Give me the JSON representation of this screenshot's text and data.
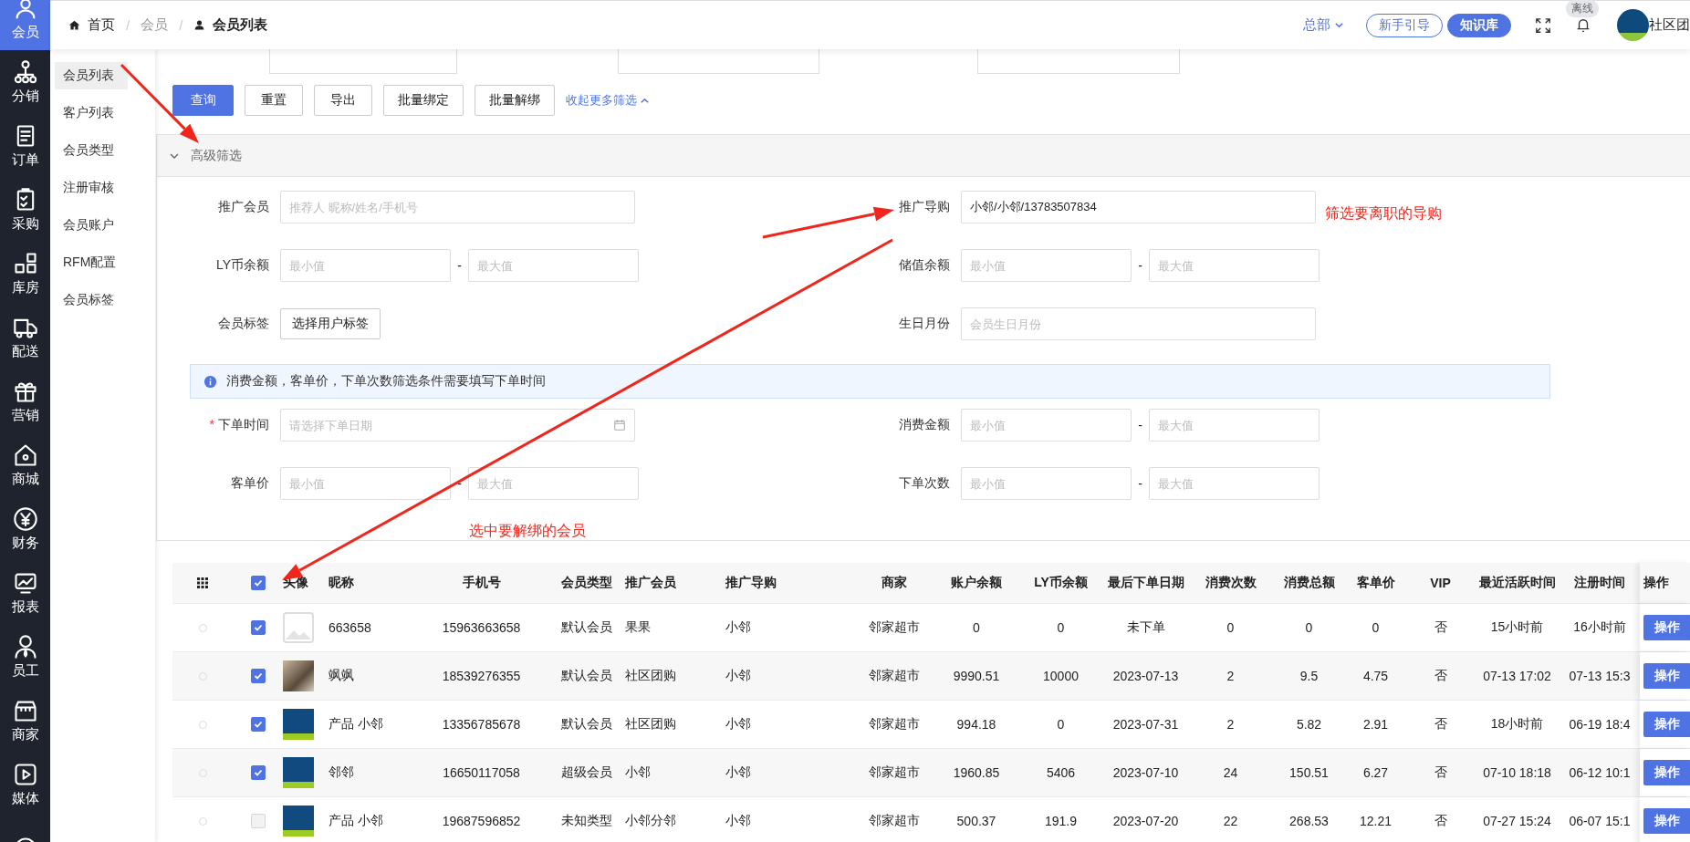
{
  "nav": {
    "items": [
      {
        "label": "会员",
        "selected": true
      },
      {
        "label": "分销",
        "selected": false
      },
      {
        "label": "订单",
        "selected": false
      },
      {
        "label": "采购",
        "selected": false
      },
      {
        "label": "库房",
        "selected": false
      },
      {
        "label": "配送",
        "selected": false
      },
      {
        "label": "营销",
        "selected": false
      },
      {
        "label": "商城",
        "selected": false
      },
      {
        "label": "财务",
        "selected": false
      },
      {
        "label": "报表",
        "selected": false
      },
      {
        "label": "员工",
        "selected": false
      },
      {
        "label": "商家",
        "selected": false
      },
      {
        "label": "媒体",
        "selected": false
      }
    ]
  },
  "breadcrumb": {
    "separator": "/",
    "items": [
      {
        "text": "首页",
        "kind": "home"
      },
      {
        "text": "会员",
        "kind": "link"
      },
      {
        "text": "会员列表",
        "kind": "current"
      }
    ]
  },
  "header": {
    "org": "总部",
    "buttons": [
      {
        "label": "新手引导",
        "kind": "outline"
      },
      {
        "label": "知识库",
        "kind": "primary"
      }
    ],
    "status_badge": "离线",
    "user_name": "社区团"
  },
  "subnav": {
    "items": [
      {
        "label": "会员列表",
        "selected": true
      },
      {
        "label": "客户列表",
        "selected": false
      },
      {
        "label": "会员类型",
        "selected": false
      },
      {
        "label": "注册审核",
        "selected": false
      },
      {
        "label": "会员账户",
        "selected": false
      },
      {
        "label": "RFM配置",
        "selected": false
      },
      {
        "label": "会员标签",
        "selected": false
      }
    ]
  },
  "actions": {
    "buttons": [
      {
        "label": "查询",
        "kind": "primary"
      },
      {
        "label": "重置",
        "kind": "default"
      },
      {
        "label": "导出",
        "kind": "default"
      },
      {
        "label": "批量绑定",
        "kind": "default"
      },
      {
        "label": "批量解绑",
        "kind": "default"
      }
    ],
    "collapse_link": "收起更多筛选"
  },
  "advanced_filter": {
    "title": "高级筛选",
    "expanded": true,
    "items": [
      {
        "kind": "row",
        "fields": [
          {
            "label": "推广会员",
            "kind": "text",
            "placeholder": "推荐人 昵称/姓名/手机号"
          },
          {
            "label": "推广导购",
            "kind": "text",
            "value": "小邻/小邻/13783507834"
          }
        ]
      },
      {
        "kind": "row",
        "fields": [
          {
            "label": "LY币余额",
            "kind": "range",
            "min_placeholder": "最小值",
            "max_placeholder": "最大值",
            "separator": "-"
          },
          {
            "label": "储值余额",
            "kind": "range",
            "min_placeholder": "最小值",
            "max_placeholder": "最大值",
            "separator": "-"
          }
        ]
      },
      {
        "kind": "row",
        "fields": [
          {
            "label": "会员标签",
            "kind": "button",
            "button": "选择用户标签"
          },
          {
            "label": "生日月份",
            "kind": "text",
            "placeholder": "会员生日月份"
          }
        ]
      },
      {
        "kind": "notice",
        "text": "消费金额，客单价，下单次数筛选条件需要填写下单时间"
      },
      {
        "kind": "row",
        "fields": [
          {
            "label": "下单时间",
            "kind": "date",
            "placeholder": "请选择下单日期",
            "required_mark": "*"
          },
          {
            "label": "消费金额",
            "kind": "range",
            "min_placeholder": "最小值",
            "max_placeholder": "最大值",
            "separator": "-"
          }
        ]
      },
      {
        "kind": "row",
        "fields": [
          {
            "label": "客单价",
            "kind": "range",
            "min_placeholder": "最小值",
            "max_placeholder": "最大值",
            "separator": "-"
          },
          {
            "label": "下单次数",
            "kind": "range",
            "min_placeholder": "最小值",
            "max_placeholder": "最大值",
            "separator": "-"
          }
        ]
      }
    ]
  },
  "table": {
    "header_checked": true,
    "avatar_header": "头像",
    "action_header": "操作",
    "columns": [
      "昵称",
      "手机号",
      "会员类型",
      "推广会员",
      "推广导购",
      "商家",
      "账户余额",
      "LY币余额",
      "最后下单日期",
      "消费次数",
      "消费总额",
      "客单价",
      "VIP",
      "最近活跃时间",
      "注册时间"
    ],
    "rows": [
      {
        "selected": false,
        "checked": true,
        "avatar": {
          "kind": "placeholder"
        },
        "cells": [
          "663658",
          "15963663658",
          "默认会员",
          "果果",
          "小邻",
          "邻家超市",
          "0",
          "0",
          "未下单",
          "0",
          "0",
          "0",
          "否",
          "15小时前",
          "16小时前"
        ],
        "action": "操作"
      },
      {
        "selected": false,
        "checked": true,
        "avatar": {
          "kind": "photo"
        },
        "cells": [
          "飒飒",
          "18539276355",
          "默认会员",
          "社区团购",
          "小邻",
          "邻家超市",
          "9990.51",
          "10000",
          "2023-07-13",
          "2",
          "9.5",
          "4.75",
          "否",
          "07-13 17:02",
          "07-13 15:3"
        ],
        "action": "操作"
      },
      {
        "selected": false,
        "checked": true,
        "avatar": {
          "kind": "logo"
        },
        "cells": [
          "产品 小邻",
          "13356785678",
          "默认会员",
          "社区团购",
          "小邻",
          "邻家超市",
          "994.18",
          "0",
          "2023-07-31",
          "2",
          "5.82",
          "2.91",
          "否",
          "18小时前",
          "06-19 18:4"
        ],
        "action": "操作"
      },
      {
        "selected": false,
        "checked": true,
        "avatar": {
          "kind": "logo"
        },
        "cells": [
          "邻邻",
          "16650117058",
          "超级会员",
          "小邻",
          "小邻",
          "邻家超市",
          "1960.85",
          "5406",
          "2023-07-10",
          "24",
          "150.51",
          "6.27",
          "否",
          "07-10 18:18",
          "06-12 10:1"
        ],
        "action": "操作"
      },
      {
        "selected": false,
        "checked": false,
        "avatar": {
          "kind": "logo"
        },
        "cells": [
          "产品 小邻",
          "19687596852",
          "未知类型",
          "小邻分邻",
          "小邻",
          "邻家超市",
          "500.37",
          "191.9",
          "2023-07-20",
          "22",
          "268.53",
          "12.21",
          "否",
          "07-27 15:24",
          "06-07 15:1"
        ],
        "action": "操作"
      }
    ]
  },
  "annotations": [
    {
      "text": "筛选要离职的导购"
    },
    {
      "text": "选中要解绑的会员"
    }
  ]
}
